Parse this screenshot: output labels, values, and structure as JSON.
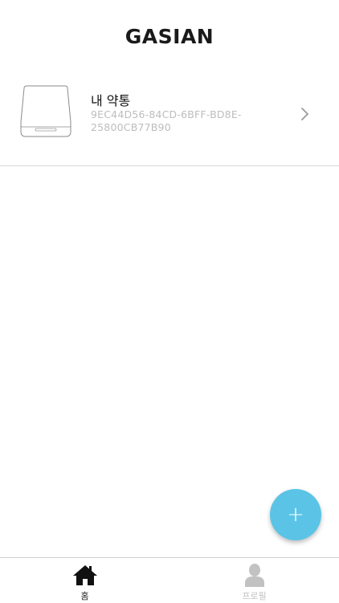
{
  "header": {
    "brand": "GASIAN"
  },
  "device": {
    "name": "내 약통",
    "id": "9EC44D56-84CD-6BFF-BD8E-25800CB77B90"
  },
  "fab": {
    "icon": "plus-icon",
    "symbol": "+"
  },
  "tabbar": {
    "tabs": [
      {
        "label": "홈",
        "icon": "home-icon",
        "active": true
      },
      {
        "label": "프로필",
        "icon": "person-icon",
        "active": false
      }
    ]
  },
  "colors": {
    "accent": "#5bc4e6",
    "inactive_tab": "#c2c2c2",
    "device_id_text": "#bdbdbd"
  }
}
